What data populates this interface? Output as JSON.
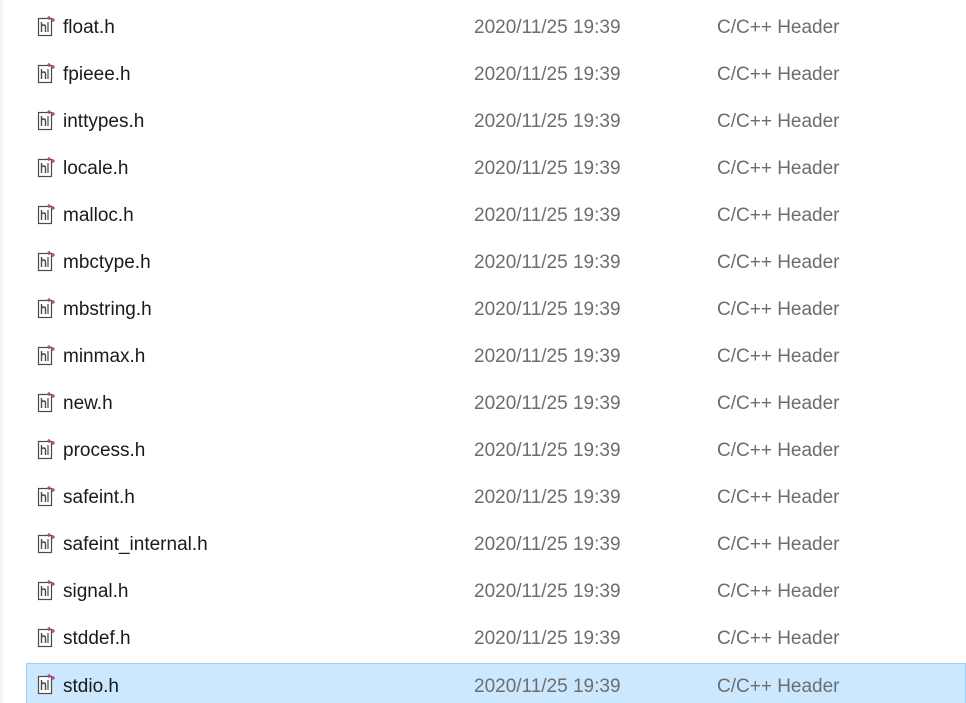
{
  "file_list": {
    "selected_index": 14,
    "icon": "c-header-file-icon",
    "colors": {
      "selection_fill": "#cce8ff",
      "selection_border": "#99d1ff",
      "icon_accent": "#b0457a"
    },
    "rows": [
      {
        "name": "float.h",
        "date": "2020/11/25 19:39",
        "type": "C/C++ Header"
      },
      {
        "name": "fpieee.h",
        "date": "2020/11/25 19:39",
        "type": "C/C++ Header"
      },
      {
        "name": "inttypes.h",
        "date": "2020/11/25 19:39",
        "type": "C/C++ Header"
      },
      {
        "name": "locale.h",
        "date": "2020/11/25 19:39",
        "type": "C/C++ Header"
      },
      {
        "name": "malloc.h",
        "date": "2020/11/25 19:39",
        "type": "C/C++ Header"
      },
      {
        "name": "mbctype.h",
        "date": "2020/11/25 19:39",
        "type": "C/C++ Header"
      },
      {
        "name": "mbstring.h",
        "date": "2020/11/25 19:39",
        "type": "C/C++ Header"
      },
      {
        "name": "minmax.h",
        "date": "2020/11/25 19:39",
        "type": "C/C++ Header"
      },
      {
        "name": "new.h",
        "date": "2020/11/25 19:39",
        "type": "C/C++ Header"
      },
      {
        "name": "process.h",
        "date": "2020/11/25 19:39",
        "type": "C/C++ Header"
      },
      {
        "name": "safeint.h",
        "date": "2020/11/25 19:39",
        "type": "C/C++ Header"
      },
      {
        "name": "safeint_internal.h",
        "date": "2020/11/25 19:39",
        "type": "C/C++ Header"
      },
      {
        "name": "signal.h",
        "date": "2020/11/25 19:39",
        "type": "C/C++ Header"
      },
      {
        "name": "stddef.h",
        "date": "2020/11/25 19:39",
        "type": "C/C++ Header"
      },
      {
        "name": "stdio.h",
        "date": "2020/11/25 19:39",
        "type": "C/C++ Header"
      }
    ]
  }
}
